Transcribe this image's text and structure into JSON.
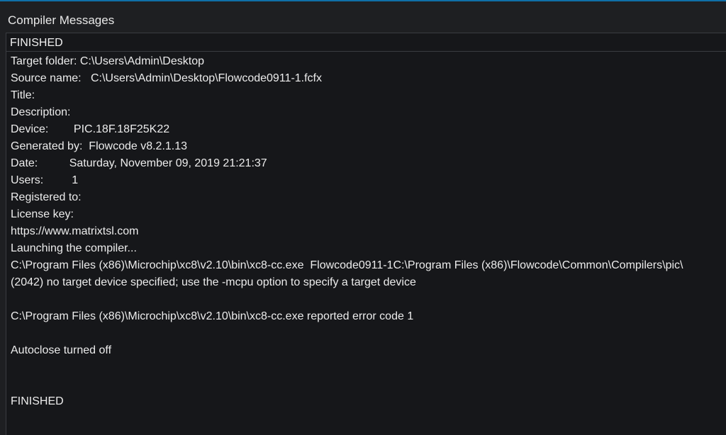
{
  "window": {
    "title": "Compiler Messages"
  },
  "status": {
    "text": "FINISHED"
  },
  "log": [
    "Target folder: C:\\Users\\Admin\\Desktop",
    "Source name:   C:\\Users\\Admin\\Desktop\\Flowcode0911-1.fcfx",
    "Title:",
    "Description:",
    "Device:        PIC.18F.18F25K22",
    "Generated by:  Flowcode v8.2.1.13",
    "Date:          Saturday, November 09, 2019 21:21:37",
    "Users:         1",
    "Registered to:",
    "License key:",
    "https://www.matrixtsl.com",
    "Launching the compiler...",
    "C:\\Program Files (x86)\\Microchip\\xc8\\v2.10\\bin\\xc8-cc.exe  Flowcode0911-1C:\\Program Files (x86)\\Flowcode\\Common\\Compilers\\pic\\",
    "(2042) no target device specified; use the -mcpu option to specify a target device",
    "",
    "C:\\Program Files (x86)\\Microchip\\xc8\\v2.10\\bin\\xc8-cc.exe reported error code 1",
    "",
    "Autoclose turned off",
    "",
    "",
    "FINISHED"
  ]
}
